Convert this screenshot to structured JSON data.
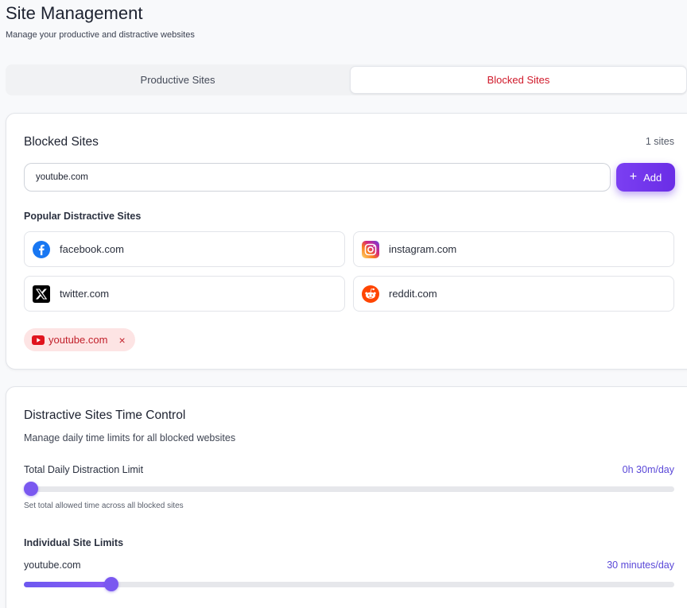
{
  "page": {
    "title": "Site Management",
    "subtitle": "Manage your productive and distractive websites"
  },
  "tabs": [
    {
      "label": "Productive Sites",
      "active": false
    },
    {
      "label": "Blocked Sites",
      "active": true
    }
  ],
  "blocked_card": {
    "title": "Blocked Sites",
    "count": "1 sites",
    "input_value": "youtube.com",
    "add_label": "Add",
    "popular_label": "Popular Distractive Sites",
    "popular_sites": [
      {
        "label": "facebook.com",
        "icon": "facebook-icon"
      },
      {
        "label": "instagram.com",
        "icon": "instagram-icon"
      },
      {
        "label": "twitter.com",
        "icon": "x-twitter-icon"
      },
      {
        "label": "reddit.com",
        "icon": "reddit-icon"
      }
    ],
    "blocked_chips": [
      {
        "label": "youtube.com",
        "icon": "youtube-icon",
        "remove": "×"
      }
    ]
  },
  "time_card": {
    "title": "Distractive Sites Time Control",
    "subtitle": "Manage daily time limits for all blocked websites",
    "total_label": "Total Daily Distraction Limit",
    "total_value": "0h 30m/day",
    "total_fraction": 0.011,
    "total_hint": "Set total allowed time across all blocked sites",
    "individual_label": "Individual Site Limits",
    "sites": [
      {
        "label": "youtube.com",
        "value": "30 minutes/day",
        "fraction": 0.134
      }
    ]
  },
  "colors": {
    "accent": "#7b3ff2",
    "blocked_red": "#d0192a",
    "value_purple": "#5a48d8"
  }
}
